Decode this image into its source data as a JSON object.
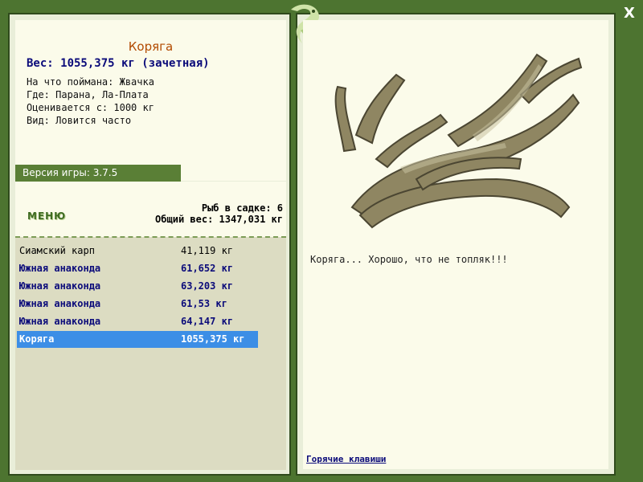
{
  "fish": {
    "name": "Коряга",
    "weight_line": "Вес: 1055,375 кг (зачетная)",
    "bait": "На что поймана: Жвачка",
    "where": "Где: Парана, Ла-Плата",
    "value": "Оценивается с: 1000 кг",
    "kind": "Вид: Ловится часто",
    "description": "Коряга... Хорошо, что не топляк!!!"
  },
  "version": "Версия игры: 3.7.5",
  "menu_label": "МЕНЮ",
  "stats": {
    "fish_in_keepnet": "Рыб в садке: 6",
    "total_weight": "Общий вес: 1347,031 кг"
  },
  "catch": [
    {
      "name": "Сиамский карп",
      "weight": "41,119 кг"
    },
    {
      "name": "Южная анаконда",
      "weight": "61,652 кг"
    },
    {
      "name": "Южная анаконда",
      "weight": "63,203 кг"
    },
    {
      "name": "Южная анаконда",
      "weight": "61,53 кг"
    },
    {
      "name": "Южная анаконда",
      "weight": "64,147 кг"
    },
    {
      "name": "Коряга",
      "weight": "1055,375 кг"
    }
  ],
  "hotkeys_link": "Горячие клавиши",
  "close_glyph": "X",
  "icons": [
    "logo-fish-icon",
    "close-icon",
    "driftwood-image"
  ],
  "colors": {
    "frame": "#4d7430",
    "panel": "#fbfbea",
    "list_bg": "#dcdcc2",
    "selected": "#3c8ee6",
    "title": "#b24a00"
  }
}
